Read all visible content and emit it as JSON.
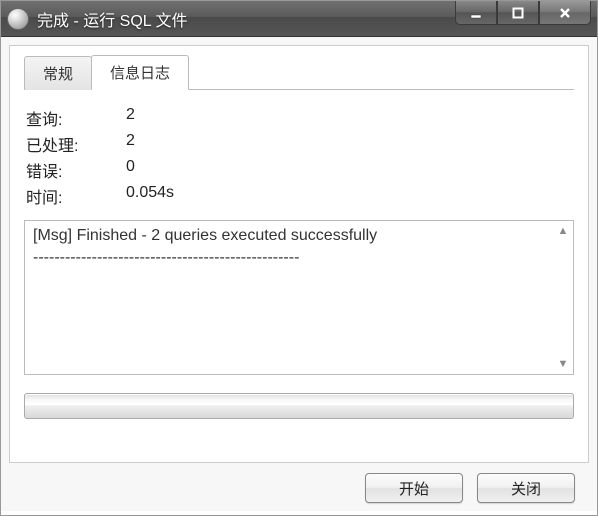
{
  "window": {
    "title": "完成 - 运行 SQL 文件"
  },
  "tabs": {
    "general": "常规",
    "log": "信息日志"
  },
  "stats": {
    "queries_label": "查询:",
    "queries_value": "2",
    "processed_label": "已处理:",
    "processed_value": "2",
    "errors_label": "错误:",
    "errors_value": "0",
    "time_label": "时间:",
    "time_value": "0.054s"
  },
  "log": {
    "line1": "[Msg] Finished - 2 queries executed successfully",
    "line2": "--------------------------------------------------"
  },
  "buttons": {
    "start": "开始",
    "close": "关闭"
  }
}
